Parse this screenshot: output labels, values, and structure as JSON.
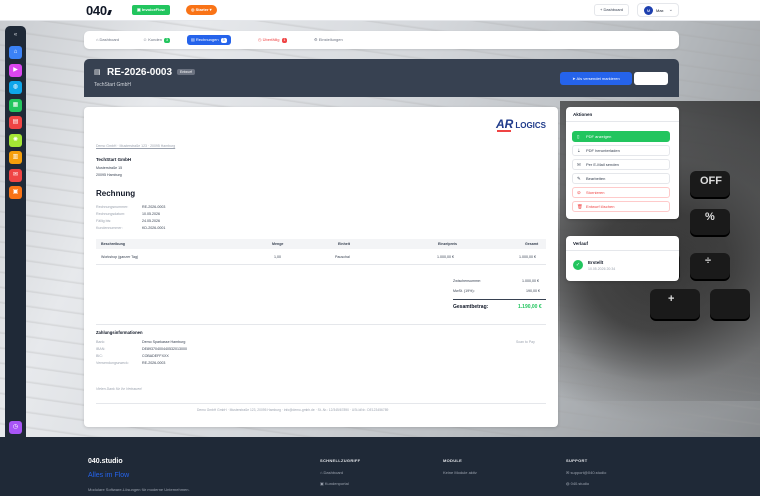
{
  "topbar": {
    "logo": "040",
    "badge_green": "InvoiceFlow",
    "badge_orange": "Starter",
    "dashboard_btn": "Dashboard",
    "user_initial": "M",
    "user_name": "Max"
  },
  "tabs": [
    {
      "label": "Dashboard",
      "icon": "home-icon"
    },
    {
      "label": "Kunden",
      "count": "3"
    },
    {
      "label": "Rechnungen",
      "count": "3",
      "active": true
    },
    {
      "label": "Überfällig",
      "count": "1"
    },
    {
      "label": "Einstellungen"
    }
  ],
  "invoice_header": {
    "number": "RE-2026-0003",
    "status": "Entwurf",
    "customer": "TechStart GmbH",
    "primary_action": "Als versendet markieren"
  },
  "document": {
    "logo_a": "AR",
    "logo_b": "LOGICS",
    "sender_line": "Demo GmbH · Musterstraße 123 · 20095 Hamburg",
    "recipient_name": "TechStart GmbH",
    "recipient_street": "Musterstraße 15",
    "recipient_city": "20095 Hamburg",
    "title": "Rechnung",
    "meta": [
      {
        "label": "Rechnungsnummer:",
        "value": "RE-2026-0003"
      },
      {
        "label": "Rechnungsdatum:",
        "value": "10.05.2026"
      },
      {
        "label": "Fällig bis:",
        "value": "24.05.2026"
      },
      {
        "label": "Kundennummer:",
        "value": "KD-2026-0001"
      }
    ],
    "table_headers": [
      "Beschreibung",
      "Menge",
      "Einheit",
      "Einzelpreis",
      "Gesamt"
    ],
    "rows": [
      {
        "desc": "Workshop (ganzer Tag)",
        "qty": "1,00",
        "unit": "Pauschal",
        "price": "1.000,00 €",
        "total": "1.000,00 €"
      }
    ],
    "subtotal_label": "Zwischensumme:",
    "subtotal": "1.000,00 €",
    "tax_label": "MwSt. (19%):",
    "tax": "190,00 €",
    "total_label": "Gesamtbetrag:",
    "total": "1.190,00 €",
    "payment_title": "Zahlungsinformationen",
    "payment": [
      {
        "label": "Bank:",
        "value": "Demo Sparkasse Hamburg"
      },
      {
        "label": "IBAN:",
        "value": "DE89370400440532013000"
      },
      {
        "label": "BIC:",
        "value": "COBADEFFXXX"
      },
      {
        "label": "Verwendungszweck:",
        "value": "RE-2026-0003"
      }
    ],
    "qr_hint": "Scan to Pay",
    "thanks": "Vielen Dank für Ihr Vertrauen!",
    "footer_line": "Demo GmbH GmbH · Musterstraße 123, 20095 Hamburg · info@demo-gmbh.de · St.-Nr.: 12/345/67890 · USt-IdNr.: DE123456789"
  },
  "actions": {
    "title": "Aktionen",
    "items": [
      {
        "label": "PDF anzeigen",
        "icon": "document-icon",
        "style": "green"
      },
      {
        "label": "PDF herunterladen",
        "icon": "download-icon",
        "style": "default"
      },
      {
        "label": "Per E-Mail senden",
        "icon": "mail-icon",
        "style": "default"
      },
      {
        "label": "Bearbeiten",
        "icon": "edit-icon",
        "style": "default"
      },
      {
        "label": "Stornieren",
        "icon": "cancel-icon",
        "style": "danger"
      },
      {
        "label": "Entwurf löschen",
        "icon": "trash-icon",
        "style": "danger"
      }
    ]
  },
  "history": {
    "title": "Verlauf",
    "event": "Erstellt",
    "time": "10.05.2026 20:34"
  },
  "footer": {
    "brand": "040.studio",
    "tagline": "Alles im Flow",
    "desc": "Modulare Software-Lösungen für moderne Unternehmen.",
    "col1_title": "SCHNELLZUGRIFF",
    "col1_items": [
      "Dashboard",
      "Kundenportal"
    ],
    "col2_title": "MODULE",
    "col2_items": [
      "Keine Module aktiv"
    ],
    "col3_title": "SUPPORT",
    "col3_items": [
      "support@040.studio",
      "040.studio"
    ]
  },
  "colors": {
    "accent": "#2563eb",
    "success": "#22c55e",
    "danger": "#ef4444",
    "warning": "#f97316"
  }
}
